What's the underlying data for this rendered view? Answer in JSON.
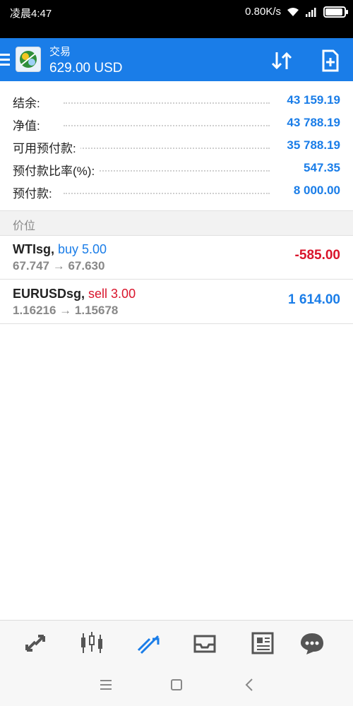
{
  "status_bar": {
    "time": "凌晨4:47",
    "speed": "0.80K/s"
  },
  "header": {
    "title": "交易",
    "balance": "629.00 USD",
    "icons": [
      "menu-icon",
      "app-logo-icon",
      "sort-icon",
      "new-order-icon"
    ],
    "accent": "#1a7de8"
  },
  "account": {
    "rows": [
      {
        "label": "结余:",
        "value": "43 159.19"
      },
      {
        "label": "净值:",
        "value": "43 788.19"
      },
      {
        "label": "可用预付款:",
        "value": "35 788.19"
      },
      {
        "label": "预付款比率(%):",
        "value": "547.35"
      },
      {
        "label": "预付款:",
        "value": "8 000.00"
      }
    ]
  },
  "section": {
    "label": "价位"
  },
  "positions": [
    {
      "symbol": "WTIsg,",
      "side": "buy 5.00",
      "prices": "67.747 → 67.630",
      "profit": "-585.00",
      "direction": "buy"
    },
    {
      "symbol": "EURUSDsg,",
      "side": "sell 3.00",
      "prices": "1.16216 → 1.15678",
      "profit": "1 614.00",
      "direction": "sell"
    }
  ],
  "tabbar": {
    "items": [
      "quotes-icon",
      "chart-icon",
      "trade-icon",
      "history-icon",
      "news-icon",
      "chat-icon"
    ],
    "active": "trade-icon"
  },
  "sysnav": {
    "items": [
      "menu-nav-icon",
      "home-nav-icon",
      "back-nav-icon"
    ]
  }
}
